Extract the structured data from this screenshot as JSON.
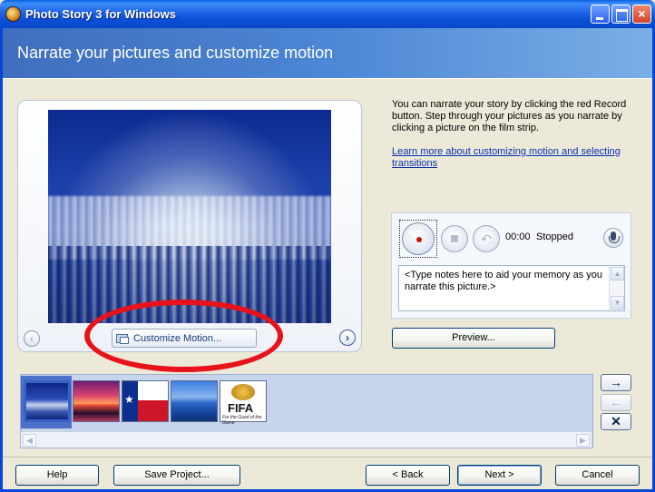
{
  "window": {
    "title": "Photo Story 3 for Windows",
    "controls": {
      "minimize": "minimize-icon",
      "maximize": "maximize-icon",
      "close": "×"
    }
  },
  "header": {
    "title": "Narrate your pictures and customize motion"
  },
  "preview": {
    "customize_motion_label": "Customize Motion...",
    "prev_icon": "‹",
    "next_icon": "›"
  },
  "instructions": {
    "text": "You can narrate your story by clicking the red Record button. Step through your pictures as you narrate by clicking a picture on the film strip.",
    "link": "Learn more about customizing motion and selecting transitions"
  },
  "narration": {
    "time": "00:00",
    "status": "Stopped",
    "notes_placeholder": "<Type notes here to aid your memory as you narrate this picture.>",
    "record_color": "#cf1111",
    "icons": {
      "record": "record-icon",
      "stop": "stop-icon",
      "undo": "undo-icon",
      "mic": "microphone-icon"
    }
  },
  "buttons": {
    "preview": "Preview...",
    "help": "Help",
    "save_project": "Save Project...",
    "back": "< Back",
    "next": "Next >",
    "cancel": "Cancel"
  },
  "filmstrip": {
    "thumbnails": [
      "winter forest",
      "sunset",
      "texas flag",
      "blue mountains",
      "fifa logo"
    ],
    "selected_index": 0,
    "fifa_text": "FIFA",
    "fifa_tagline": "For the Good of the Game",
    "side_buttons": {
      "move_right": "→",
      "move_left": "←",
      "remove": "✕"
    }
  },
  "annotation": {
    "ellipse_color": "#e8121a"
  }
}
